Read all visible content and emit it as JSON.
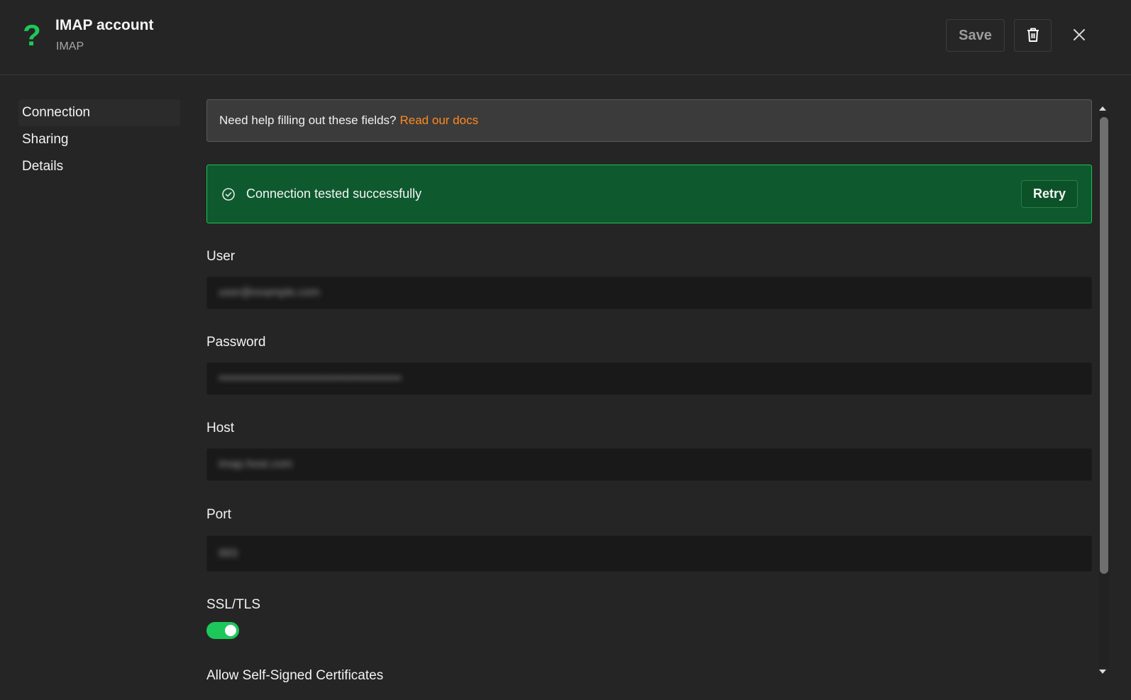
{
  "header": {
    "icon": "question-icon",
    "title": "IMAP account",
    "subtitle": "IMAP",
    "save_label": "Save",
    "delete_icon": "trash-icon",
    "close_icon": "close-icon"
  },
  "sidebar": {
    "items": [
      {
        "label": "Connection",
        "active": true
      },
      {
        "label": "Sharing",
        "active": false
      },
      {
        "label": "Details",
        "active": false
      }
    ]
  },
  "help": {
    "text": "Need help filling out these fields?",
    "link": "Read our docs"
  },
  "status": {
    "icon": "check-circle-icon",
    "text": "Connection tested successfully",
    "retry_label": "Retry"
  },
  "fields": {
    "user": {
      "label": "User",
      "value": "user@example.com"
    },
    "password": {
      "label": "Password",
      "value": "••••••••••••••••••••••••••••••••••••••••••••••"
    },
    "host": {
      "label": "Host",
      "value": "imap.host.com"
    },
    "port": {
      "label": "Port",
      "value": "993"
    },
    "ssl": {
      "label": "SSL/TLS",
      "enabled": true
    },
    "self_signed": {
      "label": "Allow Self-Signed Certificates"
    }
  },
  "colors": {
    "accent_green": "#1ec75a",
    "success_bg": "#0e5a2e",
    "link_orange": "#ff8a1f",
    "background": "#252525"
  }
}
